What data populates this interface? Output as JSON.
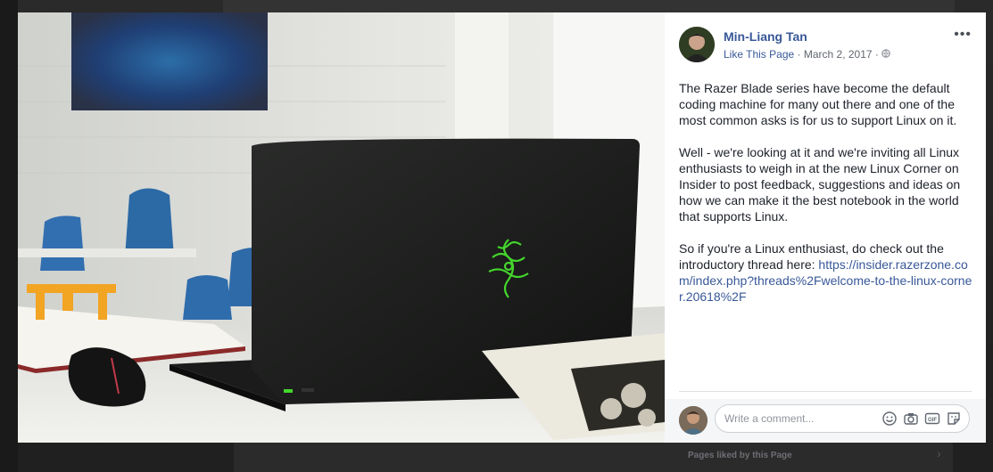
{
  "background": {
    "pages_liked_label": "Pages liked by this Page"
  },
  "post": {
    "author": "Min-Liang Tan",
    "like_page": "Like This Page",
    "separator": " · ",
    "date": "March 2, 2017",
    "audience_icon": "globe-icon",
    "more_icon": "more-options-icon",
    "more_text": "•••",
    "paragraphs": [
      "The Razer Blade series have become the default coding machine for many out there and one of the most common asks is for us to support Linux on it.",
      "Well - we're looking at it and we're inviting all Linux enthusiasts to weigh in at the new Linux Corner on Insider to post feedback, suggestions and ideas on how we can make it the best notebook in the world that supports Linux.",
      "So if you're a Linux enthusiast, do check out the introductory thread here: "
    ],
    "link": "https://insider.razerzone.com/index.php?threads%2Fwelcome-to-the-linux-corner.20618%2F"
  },
  "comment": {
    "placeholder": "Write a comment...",
    "icons": [
      "emoji-icon",
      "camera-icon",
      "gif-icon",
      "sticker-icon"
    ]
  },
  "colors": {
    "link": "#385898",
    "text": "#1d2129",
    "meta": "#616770",
    "razer_green": "#44d62c"
  }
}
